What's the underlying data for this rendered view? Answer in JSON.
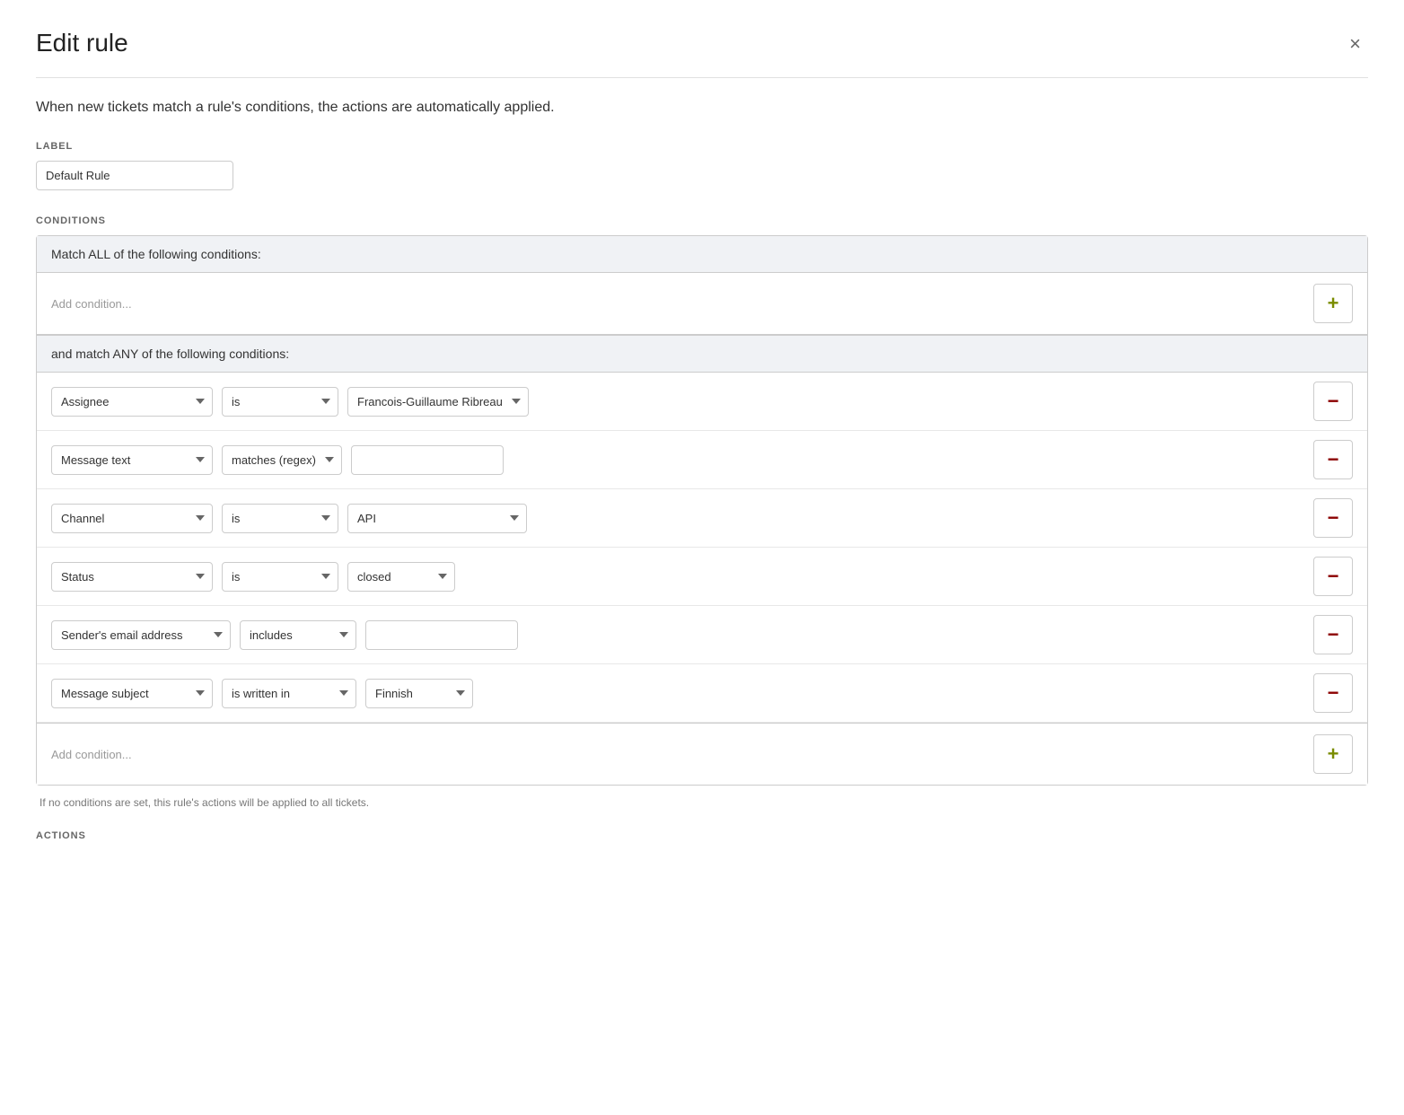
{
  "modal": {
    "title": "Edit rule",
    "close_icon": "×"
  },
  "description": "When new tickets match a rule's conditions, the actions are automatically applied.",
  "label_section": {
    "label": "LABEL",
    "value": "Default Rule"
  },
  "conditions_section": {
    "label": "CONDITIONS",
    "all_group_header": "Match ALL of the following conditions:",
    "add_condition_all": "Add condition...",
    "any_group_header": "and match ANY of the following conditions:",
    "add_condition_any": "Add condition...",
    "footer_note": "If no conditions are set, this rule's actions will be applied to all tickets.",
    "rows": [
      {
        "field": "Assignee",
        "operator": "is",
        "value_type": "select",
        "value": "Francois-Guillaume Ribreau"
      },
      {
        "field": "Message text",
        "operator": "matches (regex)",
        "value_type": "text",
        "value": ""
      },
      {
        "field": "Channel",
        "operator": "is",
        "value_type": "select",
        "value": "API"
      },
      {
        "field": "Status",
        "operator": "is",
        "value_type": "select",
        "value": "closed"
      },
      {
        "field": "Sender's email address",
        "operator": "includes",
        "value_type": "text",
        "value": ""
      },
      {
        "field": "Message subject",
        "operator": "is written in",
        "value_type": "select",
        "value": "Finnish"
      }
    ]
  },
  "actions_section": {
    "label": "ACTIONS"
  }
}
